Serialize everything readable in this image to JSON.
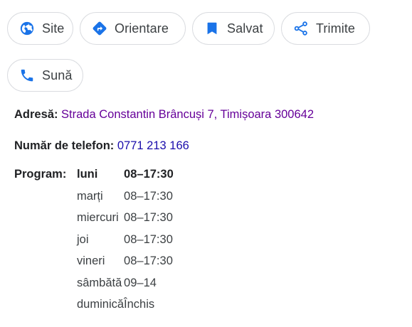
{
  "actions": {
    "row1": [
      {
        "id": "site",
        "label": "Site",
        "icon": "globe-icon"
      },
      {
        "id": "orientare",
        "label": "Orientare",
        "icon": "directions-icon"
      },
      {
        "id": "salvat",
        "label": "Salvat",
        "icon": "bookmark-icon"
      },
      {
        "id": "trimite",
        "label": "Trimite",
        "icon": "share-icon"
      }
    ],
    "row2": [
      {
        "id": "suna",
        "label": "Sună",
        "icon": "phone-icon"
      }
    ]
  },
  "info": {
    "address_label": "Adresă:",
    "address_value": "Strada Constantin Brâncuși 7, Timișoara 300642",
    "phone_label": "Număr de telefon:",
    "phone_value": "0771 213 166",
    "hours_label": "Program:"
  },
  "hours": [
    {
      "day": "luni",
      "time": "08–17:30",
      "current": true
    },
    {
      "day": "marți",
      "time": "08–17:30",
      "current": false
    },
    {
      "day": "miercuri",
      "time": "08–17:30",
      "current": false
    },
    {
      "day": "joi",
      "time": "08–17:30",
      "current": false
    },
    {
      "day": "vineri",
      "time": "08–17:30",
      "current": false
    },
    {
      "day": "sâmbătă",
      "time": "09–14",
      "current": false
    },
    {
      "day": "duminică",
      "time": "Închis",
      "current": false
    }
  ],
  "colors": {
    "accent_blue": "#1a73e8",
    "visited_link": "#660099",
    "link": "#1a0dab",
    "chip_border": "#dadce0"
  }
}
